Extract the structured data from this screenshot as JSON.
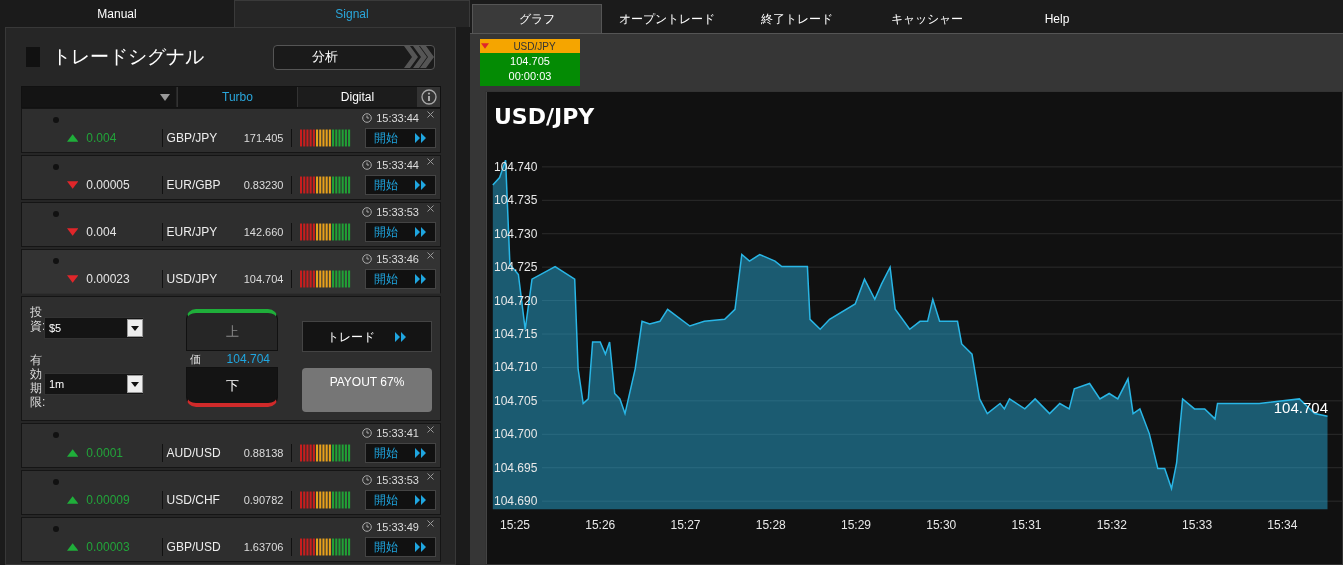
{
  "mode_tabs": [
    {
      "label": "Manual",
      "selected": false
    },
    {
      "label": "Signal",
      "selected": true
    }
  ],
  "signal_panel": {
    "title": "トレードシグナル",
    "analyze_button": "分析",
    "filter_tabs": [
      {
        "label": "Turbo",
        "selected": true
      },
      {
        "label": "Digital",
        "selected": false
      }
    ],
    "signals": [
      {
        "rising": true,
        "change": "0.004",
        "pair": "GBP/JPY",
        "price": "171.405",
        "time": "15:33:44",
        "button": "開始",
        "expanded": false
      },
      {
        "rising": false,
        "change": "0.00005",
        "pair": "EUR/GBP",
        "price": "0.83230",
        "time": "15:33:44",
        "button": "開始",
        "expanded": false
      },
      {
        "rising": false,
        "change": "0.004",
        "pair": "EUR/JPY",
        "price": "142.660",
        "time": "15:33:53",
        "button": "開始",
        "expanded": false
      },
      {
        "rising": false,
        "change": "0.00023",
        "pair": "USD/JPY",
        "price": "104.704",
        "time": "15:33:46",
        "button": "開始",
        "expanded": true
      },
      {
        "rising": true,
        "change": "0.0001",
        "pair": "AUD/USD",
        "price": "0.88138",
        "time": "15:33:41",
        "button": "開始",
        "expanded": false
      },
      {
        "rising": true,
        "change": "0.00009",
        "pair": "USD/CHF",
        "price": "0.90782",
        "time": "15:33:53",
        "button": "開始",
        "expanded": false
      },
      {
        "rising": true,
        "change": "0.00003",
        "pair": "GBP/USD",
        "price": "1.63706",
        "time": "15:33:49",
        "button": "開始",
        "expanded": false
      }
    ],
    "trade_form": {
      "investment_label": "投資:",
      "investment_value": "$5",
      "expiry_label": "有効期限:",
      "expiry_value": "1m",
      "up_button": "上",
      "down_button": "下",
      "price_label": "価",
      "price_value": "104.704",
      "trade_button": "トレード",
      "payout": "PAYOUT 67%"
    }
  },
  "main_tabs": [
    {
      "label": "グラフ",
      "selected": true
    },
    {
      "label": "オープントレード",
      "selected": false
    },
    {
      "label": "終了トレード",
      "selected": false
    },
    {
      "label": "キャッシャー",
      "selected": false
    },
    {
      "label": "Help",
      "selected": false
    }
  ],
  "ticker": {
    "rising": false,
    "pair": "USD/JPY",
    "price": "104.705",
    "timer": "00:00:03"
  },
  "chart": {
    "current_price_label": "104.704",
    "chart_data": {
      "type": "area",
      "title": "USD/JPY",
      "x": [
        924.74,
        924.82,
        924.89,
        924.94,
        925.04,
        925.12,
        925.2,
        925.47,
        925.7,
        925.74,
        925.8,
        925.86,
        925.91,
        926.0,
        926.06,
        926.11,
        926.17,
        926.23,
        926.29,
        926.41,
        926.49,
        926.58,
        926.7,
        926.79,
        927.05,
        927.22,
        927.46,
        927.58,
        927.66,
        927.75,
        927.87,
        928.05,
        928.13,
        928.43,
        928.46,
        928.58,
        928.69,
        928.99,
        929.1,
        929.22,
        929.3,
        929.4,
        929.46,
        929.63,
        929.75,
        929.84,
        929.9,
        929.98,
        930.19,
        930.24,
        930.36,
        930.45,
        930.54,
        930.69,
        930.74,
        930.8,
        930.98,
        931.1,
        931.27,
        931.39,
        931.5,
        931.56,
        931.74,
        931.86,
        931.97,
        932.07,
        932.19,
        932.25,
        932.33,
        932.44,
        932.54,
        932.62,
        932.7,
        932.76,
        932.83,
        932.97,
        933.09,
        933.21,
        933.24,
        933.73,
        934.2,
        934.38,
        934.53
      ],
      "series": [
        {
          "color": "#29b6e6",
          "values": [
            104.7373,
            104.7384,
            104.741,
            104.7254,
            104.7239,
            104.7157,
            104.7232,
            104.7251,
            104.7232,
            104.7098,
            104.7046,
            104.7053,
            104.7138,
            104.7138,
            104.712,
            104.7138,
            104.7061,
            104.7053,
            104.7031,
            104.7098,
            104.7169,
            104.7165,
            104.7169,
            104.7187,
            104.7162,
            104.7169,
            104.7172,
            104.7187,
            104.7269,
            104.7259,
            104.7269,
            104.7259,
            104.7251,
            104.7251,
            104.7172,
            104.7157,
            104.7172,
            104.7195,
            104.7232,
            104.7202,
            104.7225,
            104.725,
            104.7187,
            104.7157,
            104.7169,
            104.7169,
            104.7202,
            104.7169,
            104.7169,
            104.7135,
            104.712,
            104.7053,
            104.7031,
            104.7046,
            104.7038,
            104.7053,
            104.7038,
            104.7053,
            104.7031,
            104.7046,
            104.7038,
            104.7068,
            104.7076,
            104.7053,
            104.7061,
            104.7053,
            104.7083,
            104.7031,
            104.7038,
            104.7001,
            104.6949,
            104.6949,
            104.6919,
            104.6957,
            104.7053,
            104.7038,
            104.7038,
            104.7023,
            104.7046,
            104.7046,
            104.7053,
            104.7031,
            104.7027
          ]
        }
      ],
      "grid": true,
      "xlim": [
        924.66,
        934.7
      ],
      "ylim": [
        104.6806,
        104.7512
      ],
      "xticks": [
        {
          "value": 925,
          "label": "15:25"
        },
        {
          "value": 926,
          "label": "15:26"
        },
        {
          "value": 927,
          "label": "15:27"
        },
        {
          "value": 928,
          "label": "15:28"
        },
        {
          "value": 929,
          "label": "15:29"
        },
        {
          "value": 930,
          "label": "15:30"
        },
        {
          "value": 931,
          "label": "15:31"
        },
        {
          "value": 932,
          "label": "15:32"
        },
        {
          "value": 933,
          "label": "15:33"
        },
        {
          "value": 934,
          "label": "15:34"
        }
      ],
      "yticks": [
        {
          "value": 104.69,
          "label": "104.690"
        },
        {
          "value": 104.695,
          "label": "104.695"
        },
        {
          "value": 104.7,
          "label": "104.700"
        },
        {
          "value": 104.705,
          "label": "104.705"
        },
        {
          "value": 104.71,
          "label": "104.710"
        },
        {
          "value": 104.715,
          "label": "104.715"
        },
        {
          "value": 104.72,
          "label": "104.720"
        },
        {
          "value": 104.725,
          "label": "104.725"
        },
        {
          "value": 104.73,
          "label": "104.730"
        },
        {
          "value": 104.735,
          "label": "104.735"
        },
        {
          "value": 104.74,
          "label": "104.740"
        }
      ]
    }
  }
}
